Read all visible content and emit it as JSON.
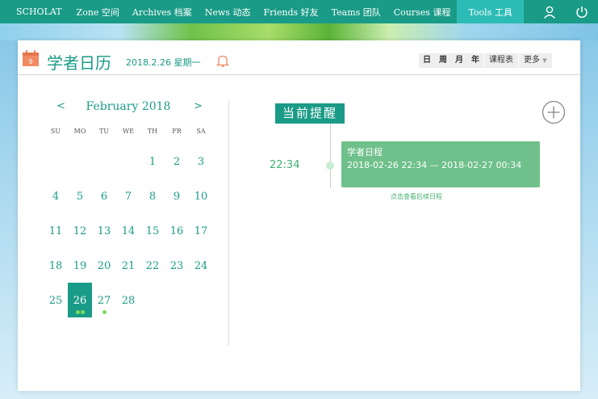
{
  "nav": {
    "brand": "SCHOLAT",
    "items": [
      {
        "label": "Zone 空间"
      },
      {
        "label": "Archives 档案"
      },
      {
        "label": "News 动态"
      },
      {
        "label": "Friends 好友"
      },
      {
        "label": "Teams 团队"
      },
      {
        "label": "Courses 课程"
      },
      {
        "label": "Tools 工具",
        "active": true
      }
    ],
    "icons": [
      "user-icon",
      "power-icon"
    ]
  },
  "header": {
    "icon": "calendar-icon",
    "title": "学者日历",
    "date": "2018.2.26 星期一",
    "bell_icon": "bell-icon",
    "views": [
      "日",
      "周",
      "月",
      "年"
    ],
    "schedule_label": "课程表",
    "more_label": "更多"
  },
  "calendar": {
    "prev": "<",
    "next": ">",
    "month_label": "February  2018",
    "weekdays": [
      "SU",
      "MO",
      "TU",
      "WE",
      "TH",
      "FR",
      "SA"
    ],
    "first_weekday": 4,
    "days_in_month": 28,
    "selected_day": 26,
    "event_dots": {
      "26": 2,
      "27": 1
    }
  },
  "reminders": {
    "title": "当前提醒",
    "add_icon": "plus-circle-icon",
    "items": [
      {
        "time": "22:34",
        "title": "学者日程",
        "range": "2018-02-26 22:34 — 2018-02-27 00:34"
      }
    ],
    "more_link": "点击查看后续日程"
  },
  "colors": {
    "accent": "#1a9b87",
    "tab_active": "#2dbcb5",
    "event": "#6fc08a",
    "dot": "#7ed957"
  }
}
